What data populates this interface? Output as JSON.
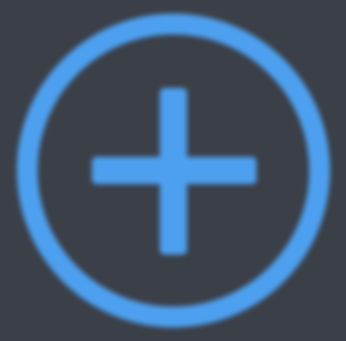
{
  "icon": "add-circle-icon",
  "colors": {
    "background": "#3b3f48",
    "accent": "#4ea0f0"
  }
}
